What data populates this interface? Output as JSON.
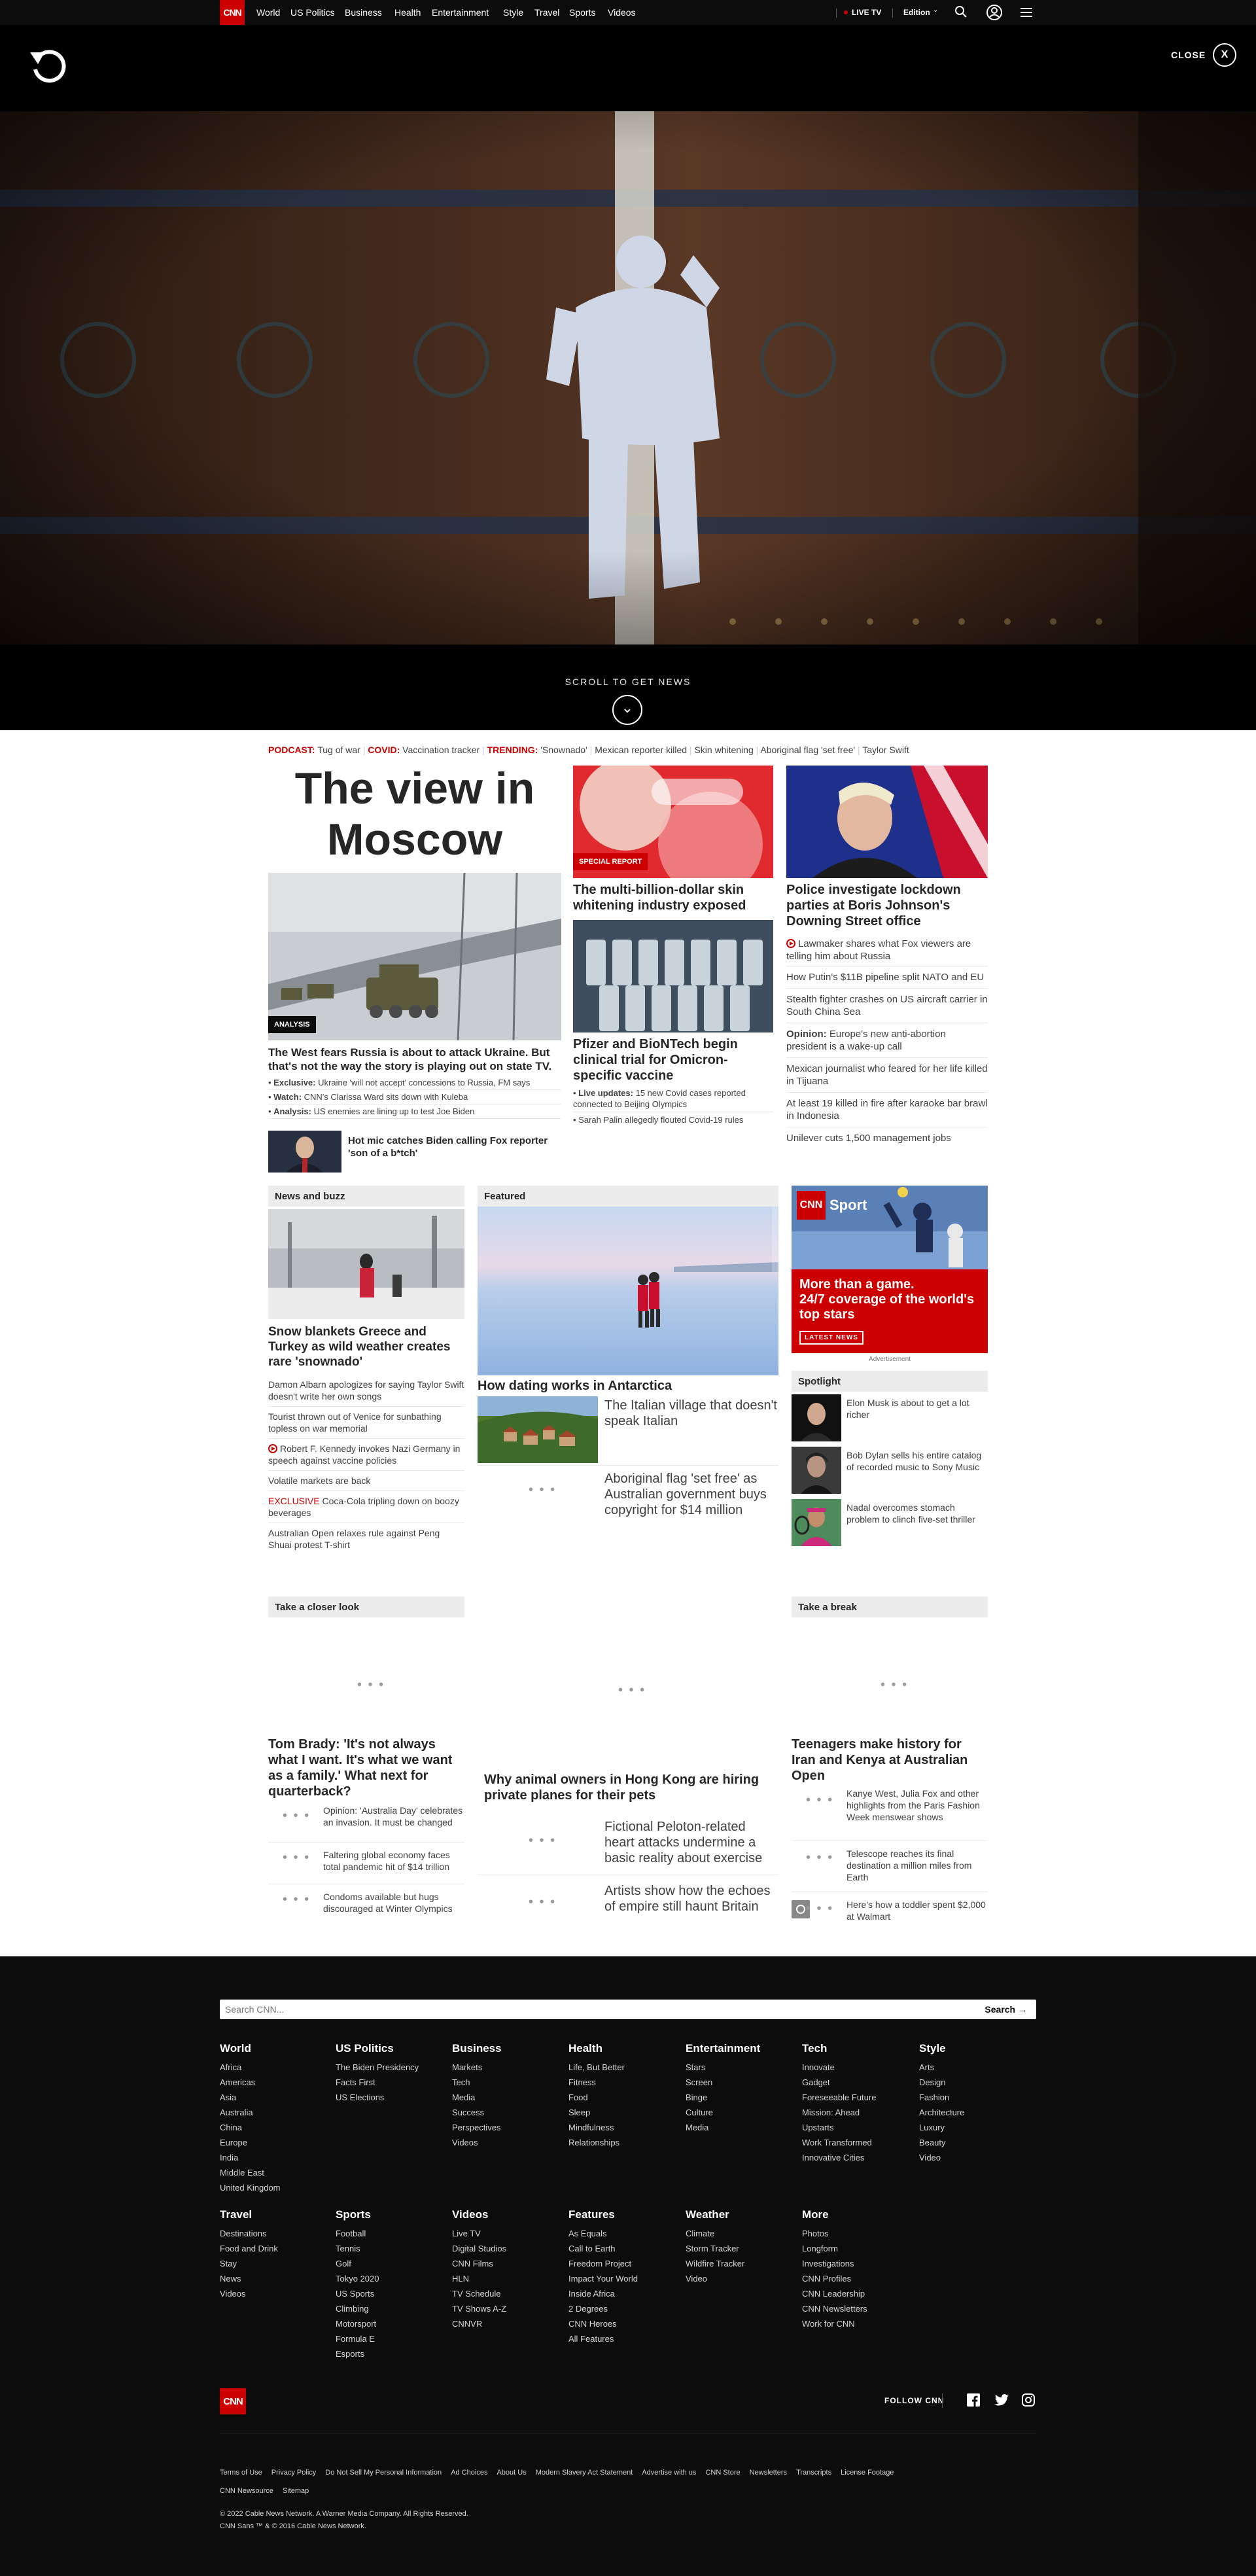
{
  "nav": {
    "logo": "CNN",
    "items": [
      "World",
      "US Politics",
      "Business",
      "Health",
      "Entertainment",
      "Style",
      "Travel",
      "Sports",
      "Videos"
    ],
    "live": "LIVE TV",
    "edition": "Edition"
  },
  "hero": {
    "close": "CLOSE",
    "scroll": "SCROLL TO GET NEWS"
  },
  "trending": {
    "podcast_label": "PODCAST:",
    "podcast": "Tug of war",
    "covid_label": "COVID:",
    "covid": "Vaccination tracker",
    "trending_label": "TRENDING:",
    "items": [
      "'Snownado'",
      "Mexican reporter killed",
      "Skin whitening",
      "Aboriginal flag 'set free'",
      "Taylor Swift"
    ]
  },
  "lead": {
    "title": "The view in Moscow",
    "badge": "ANALYSIS",
    "headline": "The West fears Russia is about to attack Ukraine. But that's not the way the story is playing out on state TV.",
    "bullets": [
      {
        "b": "Exclusive:",
        "t": "Ukraine 'will not accept' concessions to Russia, FM says"
      },
      {
        "b": "Watch:",
        "t": "CNN's Clarissa Ward sits down with Kuleba"
      },
      {
        "b": "Analysis:",
        "t": "US enemies are lining up to test Joe Biden"
      }
    ],
    "small": "Hot mic catches Biden calling Fox reporter 'son of a b*tch'"
  },
  "mid": {
    "badge": "SPECIAL REPORT",
    "h1": "The multi-billion-dollar skin whitening industry exposed",
    "h2": "Pfizer and BioNTech begin clinical trial for Omicron-specific vaccine",
    "live_b": "Live updates:",
    "live_t": "15 new Covid cases reported connected to Beijing Olympics",
    "sub": "Sarah Palin allegedly flouted Covid-19 rules"
  },
  "right": {
    "h": "Police investigate lockdown parties at Boris Johnson's Downing Street office",
    "items": [
      "Lawmaker shares what Fox viewers are telling him about Russia",
      "How Putin's $11B pipeline split NATO and EU",
      "Stealth fighter crashes on US aircraft carrier in South China Sea",
      "Europe's new anti-abortion president is a wake-up call",
      "Mexican journalist who feared for her life killed in Tijuana",
      "At least 19 killed in fire after karaoke bar brawl in Indonesia",
      "Unilever cuts 1,500 management jobs"
    ],
    "opinion": "Opinion:"
  },
  "buzz": {
    "label": "News and buzz",
    "h": "Snow blankets Greece and Turkey as wild weather creates rare 'snownado'",
    "items": [
      "Damon Albarn apologizes for saying Taylor Swift doesn't write her own songs",
      "Tourist thrown out of Venice for sunbathing topless on war memorial",
      "Robert F. Kennedy invokes Nazi Germany in speech against vaccine policies",
      "Volatile markets are back",
      "Coca-Cola tripling down on boozy beverages",
      "Australian Open relaxes rule against Peng Shuai protest T-shirt"
    ],
    "exclusive": "EXCLUSIVE"
  },
  "featured": {
    "label": "Featured",
    "h": "How dating works in Antarctica",
    "i1": "The Italian village that doesn't speak Italian",
    "i2": "Aboriginal flag 'set free' as Australian government buys copyright for $14 million"
  },
  "sport": {
    "brand": "Sport",
    "t1": "More than a game.",
    "t2": "24/7 coverage of the world's top stars",
    "cta": "LATEST NEWS",
    "ad": "Advertisement"
  },
  "spot": {
    "label": "Spotlight",
    "items": [
      "Elon Musk is about to get a lot richer",
      "Bob Dylan sells his entire catalog of recorded music to Sony Music",
      "Nadal overcomes stomach problem to clinch five-set thriller"
    ]
  },
  "closer": {
    "label": "Take a closer look",
    "h": "Tom Brady: 'It's not always what I want. It's what we want as a family.' What next for quarterback?",
    "items": [
      "Opinion: 'Australia Day' celebrates an invasion. It must be changed",
      "Faltering global economy faces total pandemic hit of $14 trillion",
      "Condoms available but hugs discouraged at Winter Olympics"
    ]
  },
  "center": {
    "h": "Why animal owners in Hong Kong are hiring private planes for their pets",
    "items": [
      "Fictional Peloton-related heart attacks undermine a basic reality about exercise",
      "Artists show how the echoes of empire still haunt Britain"
    ]
  },
  "brk": {
    "label": "Take a break",
    "h": "Teenagers make history for Iran and Kenya at Australian Open",
    "items": [
      "Kanye West, Julia Fox and other highlights from the Paris Fashion Week menswear shows",
      "Telescope reaches its final destination a million miles from Earth",
      "Here's how a toddler spent $2,000 at Walmart"
    ]
  },
  "footer": {
    "search_ph": "Search CNN...",
    "search_btn": "Search",
    "cols": [
      {
        "h": "World",
        "items": [
          "Africa",
          "Americas",
          "Asia",
          "Australia",
          "China",
          "Europe",
          "India",
          "Middle East",
          "United Kingdom"
        ]
      },
      {
        "h": "US Politics",
        "items": [
          "The Biden Presidency",
          "Facts First",
          "US Elections"
        ]
      },
      {
        "h": "Business",
        "items": [
          "Markets",
          "Tech",
          "Media",
          "Success",
          "Perspectives",
          "Videos"
        ]
      },
      {
        "h": "Health",
        "items": [
          "Life, But Better",
          "Fitness",
          "Food",
          "Sleep",
          "Mindfulness",
          "Relationships"
        ]
      },
      {
        "h": "Entertainment",
        "items": [
          "Stars",
          "Screen",
          "Binge",
          "Culture",
          "Media"
        ]
      },
      {
        "h": "Tech",
        "items": [
          "Innovate",
          "Gadget",
          "Foreseeable Future",
          "Mission: Ahead",
          "Upstarts",
          "Work Transformed",
          "Innovative Cities"
        ]
      },
      {
        "h": "Style",
        "items": [
          "Arts",
          "Design",
          "Fashion",
          "Architecture",
          "Luxury",
          "Beauty",
          "Video"
        ]
      },
      {
        "h": "Travel",
        "items": [
          "Destinations",
          "Food and Drink",
          "Stay",
          "News",
          "Videos"
        ]
      },
      {
        "h": "Sports",
        "items": [
          "Football",
          "Tennis",
          "Golf",
          "Tokyo 2020",
          "US Sports",
          "Climbing",
          "Motorsport",
          "Formula E",
          "Esports"
        ]
      },
      {
        "h": "Videos",
        "items": [
          "Live TV",
          "Digital Studios",
          "CNN Films",
          "HLN",
          "TV Schedule",
          "TV Shows A-Z",
          "CNNVR"
        ]
      },
      {
        "h": "Features",
        "items": [
          "As Equals",
          "Call to Earth",
          "Freedom Project",
          "Impact Your World",
          "Inside Africa",
          "2 Degrees",
          "CNN Heroes",
          "All Features"
        ]
      },
      {
        "h": "Weather",
        "items": [
          "Climate",
          "Storm Tracker",
          "Wildfire Tracker",
          "Video"
        ]
      },
      {
        "h": "More",
        "items": [
          "Photos",
          "Longform",
          "Investigations",
          "CNN Profiles",
          "CNN Leadership",
          "CNN Newsletters",
          "Work for CNN"
        ]
      }
    ],
    "follow": "FOLLOW CNN",
    "links": [
      "Terms of Use",
      "Privacy Policy",
      "Do Not Sell My Personal Information",
      "Ad Choices",
      "About Us",
      "Modern Slavery Act Statement",
      "Advertise with us",
      "CNN Store",
      "Newsletters",
      "Transcripts",
      "License Footage",
      "CNN Newsource",
      "Sitemap"
    ],
    "copy1": "© 2022 Cable News Network. A Warner Media Company. All Rights Reserved.",
    "copy2": "CNN Sans ™ & © 2016 Cable News Network."
  },
  "colors": {
    "red": "#cc0000",
    "dark": "#0c0c0c"
  }
}
